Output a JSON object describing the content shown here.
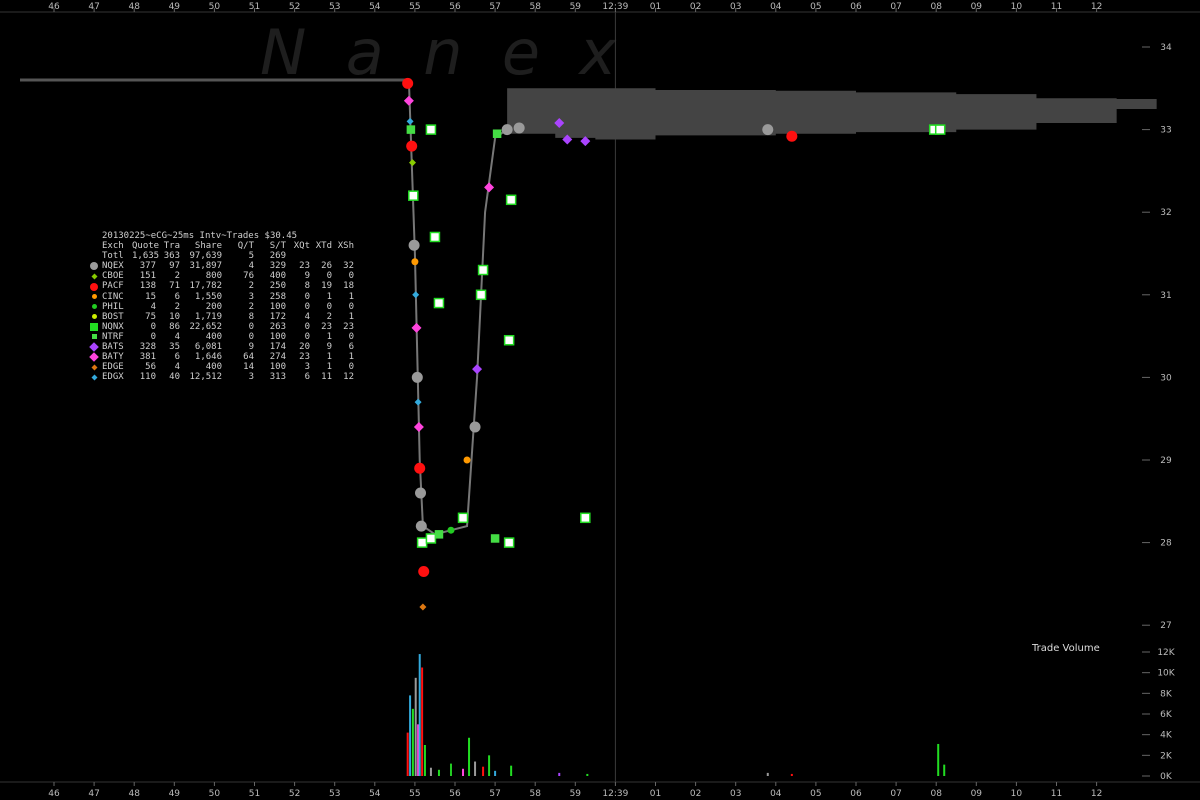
{
  "chart_data": {
    "type": "scatter",
    "title": "20130225~eCG~25ms Intv~Trades $30.45",
    "watermark": "N  a  n  e  x",
    "x_tick_labels": [
      "46",
      "47",
      "48",
      "49",
      "50",
      "51",
      "52",
      "53",
      "54",
      "55",
      "56",
      "57",
      "58",
      "59",
      "12:39",
      "01",
      "02",
      "03",
      "04",
      "05",
      "06",
      "07",
      "08",
      "09",
      "10",
      "11",
      "12"
    ],
    "price_axis": {
      "ticks": [
        "34",
        "33",
        "32",
        "31",
        "30",
        "29",
        "28",
        "27"
      ],
      "ylim": [
        27,
        34
      ]
    },
    "volume_axis": {
      "title": "Trade Volume",
      "ticks": [
        "12K",
        "10K",
        "8K",
        "6K",
        "4K",
        "2K",
        "0K"
      ],
      "ylim": [
        0,
        12000
      ]
    },
    "stats_table": {
      "headers": [
        "Exch",
        "Quote",
        "Tra",
        "Share",
        "Q/T",
        "S/T",
        "XQt",
        "XTd",
        "XSh"
      ],
      "total": [
        "Totl",
        "1,635",
        "363",
        "97,639",
        "5",
        "269",
        "",
        "",
        ""
      ],
      "rows": [
        {
          "exch": "NQEX",
          "color": "#9a9a9a",
          "shape": "circle",
          "cells": [
            "377",
            "97",
            "31,897",
            "4",
            "329",
            "23",
            "26",
            "32"
          ]
        },
        {
          "exch": "CBOE",
          "color": "#88cc00",
          "shape": "diamond-sm",
          "cells": [
            "151",
            "2",
            "800",
            "76",
            "400",
            "9",
            "0",
            "0"
          ]
        },
        {
          "exch": "PACF",
          "color": "#ff1010",
          "shape": "circle",
          "cells": [
            "138",
            "71",
            "17,782",
            "2",
            "250",
            "8",
            "19",
            "18"
          ]
        },
        {
          "exch": "CINC",
          "color": "#ff9900",
          "shape": "circle-sm",
          "cells": [
            "15",
            "6",
            "1,550",
            "3",
            "258",
            "0",
            "1",
            "1"
          ]
        },
        {
          "exch": "PHIL",
          "color": "#22cc22",
          "shape": "circle-sm",
          "cells": [
            "4",
            "2",
            "200",
            "2",
            "100",
            "0",
            "0",
            "0"
          ]
        },
        {
          "exch": "BOST",
          "color": "#ccee00",
          "shape": "circle-sm",
          "cells": [
            "75",
            "10",
            "1,719",
            "8",
            "172",
            "4",
            "2",
            "1"
          ]
        },
        {
          "exch": "NQNX",
          "color": "#22dd22",
          "shape": "square",
          "cells": [
            "0",
            "86",
            "22,652",
            "0",
            "263",
            "0",
            "23",
            "23"
          ]
        },
        {
          "exch": "NTRF",
          "color": "#44dd44",
          "shape": "square-sm",
          "cells": [
            "0",
            "4",
            "400",
            "0",
            "100",
            "0",
            "1",
            "0"
          ]
        },
        {
          "exch": "BATS",
          "color": "#aa44ff",
          "shape": "diamond",
          "cells": [
            "328",
            "35",
            "6,081",
            "9",
            "174",
            "20",
            "9",
            "6"
          ]
        },
        {
          "exch": "BATY",
          "color": "#ff44dd",
          "shape": "diamond",
          "cells": [
            "381",
            "6",
            "1,646",
            "64",
            "274",
            "23",
            "1",
            "1"
          ]
        },
        {
          "exch": "EDGE",
          "color": "#dd7711",
          "shape": "diamond-sm",
          "cells": [
            "56",
            "4",
            "400",
            "14",
            "100",
            "3",
            "1",
            "0"
          ]
        },
        {
          "exch": "EDGX",
          "color": "#33aadd",
          "shape": "diamond-sm",
          "cells": [
            "110",
            "40",
            "12,512",
            "3",
            "313",
            "6",
            "11",
            "12"
          ]
        }
      ]
    },
    "nbbo_band": [
      {
        "t": 54.0,
        "bid": 33.6,
        "ask": 33.6
      },
      {
        "t": 57.3,
        "bid": 32.95,
        "ask": 33.5
      },
      {
        "t": 58.5,
        "bid": 32.9,
        "ask": 33.5
      },
      {
        "t": 59.5,
        "bid": 32.88,
        "ask": 33.5
      },
      {
        "t": 61.0,
        "bid": 32.93,
        "ask": 33.48
      },
      {
        "t": 64.0,
        "bid": 32.95,
        "ask": 33.47
      },
      {
        "t": 66.0,
        "bid": 32.97,
        "ask": 33.45
      },
      {
        "t": 68.5,
        "bid": 33.0,
        "ask": 33.43
      },
      {
        "t": 70.5,
        "bid": 33.08,
        "ask": 33.38
      },
      {
        "t": 72.5,
        "bid": 33.25,
        "ask": 33.37
      }
    ],
    "trades": [
      {
        "t": 54.82,
        "p": 33.56,
        "ex": "PACF"
      },
      {
        "t": 54.85,
        "p": 33.35,
        "ex": "BATY"
      },
      {
        "t": 54.88,
        "p": 33.1,
        "ex": "EDGX"
      },
      {
        "t": 54.9,
        "p": 33.0,
        "ex": "NTRF"
      },
      {
        "t": 54.92,
        "p": 32.8,
        "ex": "PACF"
      },
      {
        "t": 54.94,
        "p": 32.6,
        "ex": "CBOE"
      },
      {
        "t": 54.96,
        "p": 32.2,
        "ex": "NQNX"
      },
      {
        "t": 54.98,
        "p": 31.6,
        "ex": "NQEX"
      },
      {
        "t": 55.0,
        "p": 31.4,
        "ex": "CINC"
      },
      {
        "t": 55.02,
        "p": 31.0,
        "ex": "EDGX"
      },
      {
        "t": 55.04,
        "p": 30.6,
        "ex": "BATY"
      },
      {
        "t": 55.06,
        "p": 30.0,
        "ex": "NQEX"
      },
      {
        "t": 55.08,
        "p": 29.7,
        "ex": "EDGX"
      },
      {
        "t": 55.1,
        "p": 29.4,
        "ex": "BATY"
      },
      {
        "t": 55.12,
        "p": 28.9,
        "ex": "PACF"
      },
      {
        "t": 55.14,
        "p": 28.6,
        "ex": "NQEX"
      },
      {
        "t": 55.16,
        "p": 28.2,
        "ex": "NQEX"
      },
      {
        "t": 55.18,
        "p": 28.0,
        "ex": "NQNX"
      },
      {
        "t": 55.22,
        "p": 27.65,
        "ex": "PACF"
      },
      {
        "t": 55.2,
        "p": 27.22,
        "ex": "EDGE"
      },
      {
        "t": 55.4,
        "p": 28.05,
        "ex": "NQNX"
      },
      {
        "t": 55.6,
        "p": 28.1,
        "ex": "NTRF"
      },
      {
        "t": 55.9,
        "p": 28.15,
        "ex": "PHIL"
      },
      {
        "t": 56.2,
        "p": 28.3,
        "ex": "NQNX"
      },
      {
        "t": 56.3,
        "p": 29.0,
        "ex": "CINC"
      },
      {
        "t": 56.5,
        "p": 29.4,
        "ex": "NQEX"
      },
      {
        "t": 56.55,
        "p": 30.1,
        "ex": "BATS"
      },
      {
        "t": 56.7,
        "p": 31.3,
        "ex": "NQNX"
      },
      {
        "t": 56.85,
        "p": 32.3,
        "ex": "BATY"
      },
      {
        "t": 57.05,
        "p": 32.95,
        "ex": "NTRF"
      },
      {
        "t": 57.3,
        "p": 33.0,
        "ex": "NQEX"
      },
      {
        "t": 57.6,
        "p": 33.02,
        "ex": "NQEX"
      },
      {
        "t": 58.6,
        "p": 33.08,
        "ex": "BATS"
      },
      {
        "t": 58.8,
        "p": 32.88,
        "ex": "BATS"
      },
      {
        "t": 59.25,
        "p": 32.86,
        "ex": "BATS"
      },
      {
        "t": 63.8,
        "p": 33.0,
        "ex": "NQEX"
      },
      {
        "t": 64.4,
        "p": 32.92,
        "ex": "PACF"
      },
      {
        "t": 67.95,
        "p": 33.0,
        "ex": "NQNX"
      },
      {
        "t": 68.1,
        "p": 33.0,
        "ex": "NQNX"
      },
      {
        "t": 55.4,
        "p": 33.0,
        "ex": "NQNX"
      },
      {
        "t": 55.5,
        "p": 31.7,
        "ex": "NQNX"
      },
      {
        "t": 55.6,
        "p": 30.9,
        "ex": "NQNX"
      },
      {
        "t": 57.4,
        "p": 32.15,
        "ex": "NQNX"
      },
      {
        "t": 57.35,
        "p": 30.45,
        "ex": "NQNX"
      },
      {
        "t": 57.35,
        "p": 28.0,
        "ex": "NQNX"
      },
      {
        "t": 59.25,
        "p": 28.3,
        "ex": "NQNX"
      },
      {
        "t": 57.0,
        "p": 28.05,
        "ex": "NTRF"
      },
      {
        "t": 56.65,
        "p": 31.0,
        "ex": "NQNX"
      }
    ],
    "volume": [
      {
        "t": 54.82,
        "v": 4200,
        "ex": "PACF"
      },
      {
        "t": 54.88,
        "v": 7800,
        "ex": "EDGX"
      },
      {
        "t": 54.95,
        "v": 6500,
        "ex": "NQNX"
      },
      {
        "t": 55.02,
        "v": 9500,
        "ex": "NQEX"
      },
      {
        "t": 55.08,
        "v": 5000,
        "ex": "BATY"
      },
      {
        "t": 55.12,
        "v": 11800,
        "ex": "EDGX"
      },
      {
        "t": 55.18,
        "v": 10500,
        "ex": "PACF"
      },
      {
        "t": 55.25,
        "v": 3000,
        "ex": "NQNX"
      },
      {
        "t": 55.4,
        "v": 800,
        "ex": "NQEX"
      },
      {
        "t": 55.6,
        "v": 600,
        "ex": "NQNX"
      },
      {
        "t": 55.9,
        "v": 1200,
        "ex": "PHIL"
      },
      {
        "t": 56.2,
        "v": 700,
        "ex": "BATY"
      },
      {
        "t": 56.35,
        "v": 3700,
        "ex": "NQNX"
      },
      {
        "t": 56.5,
        "v": 1400,
        "ex": "NQEX"
      },
      {
        "t": 56.7,
        "v": 900,
        "ex": "PACF"
      },
      {
        "t": 56.85,
        "v": 2000,
        "ex": "NQNX"
      },
      {
        "t": 57.0,
        "v": 500,
        "ex": "EDGX"
      },
      {
        "t": 57.4,
        "v": 1000,
        "ex": "NQNX"
      },
      {
        "t": 58.6,
        "v": 300,
        "ex": "BATS"
      },
      {
        "t": 59.3,
        "v": 200,
        "ex": "NQNX"
      },
      {
        "t": 63.8,
        "v": 300,
        "ex": "NQEX"
      },
      {
        "t": 64.4,
        "v": 200,
        "ex": "PACF"
      },
      {
        "t": 68.05,
        "v": 3100,
        "ex": "NQNX"
      },
      {
        "t": 68.2,
        "v": 1100,
        "ex": "NQNX"
      }
    ]
  }
}
